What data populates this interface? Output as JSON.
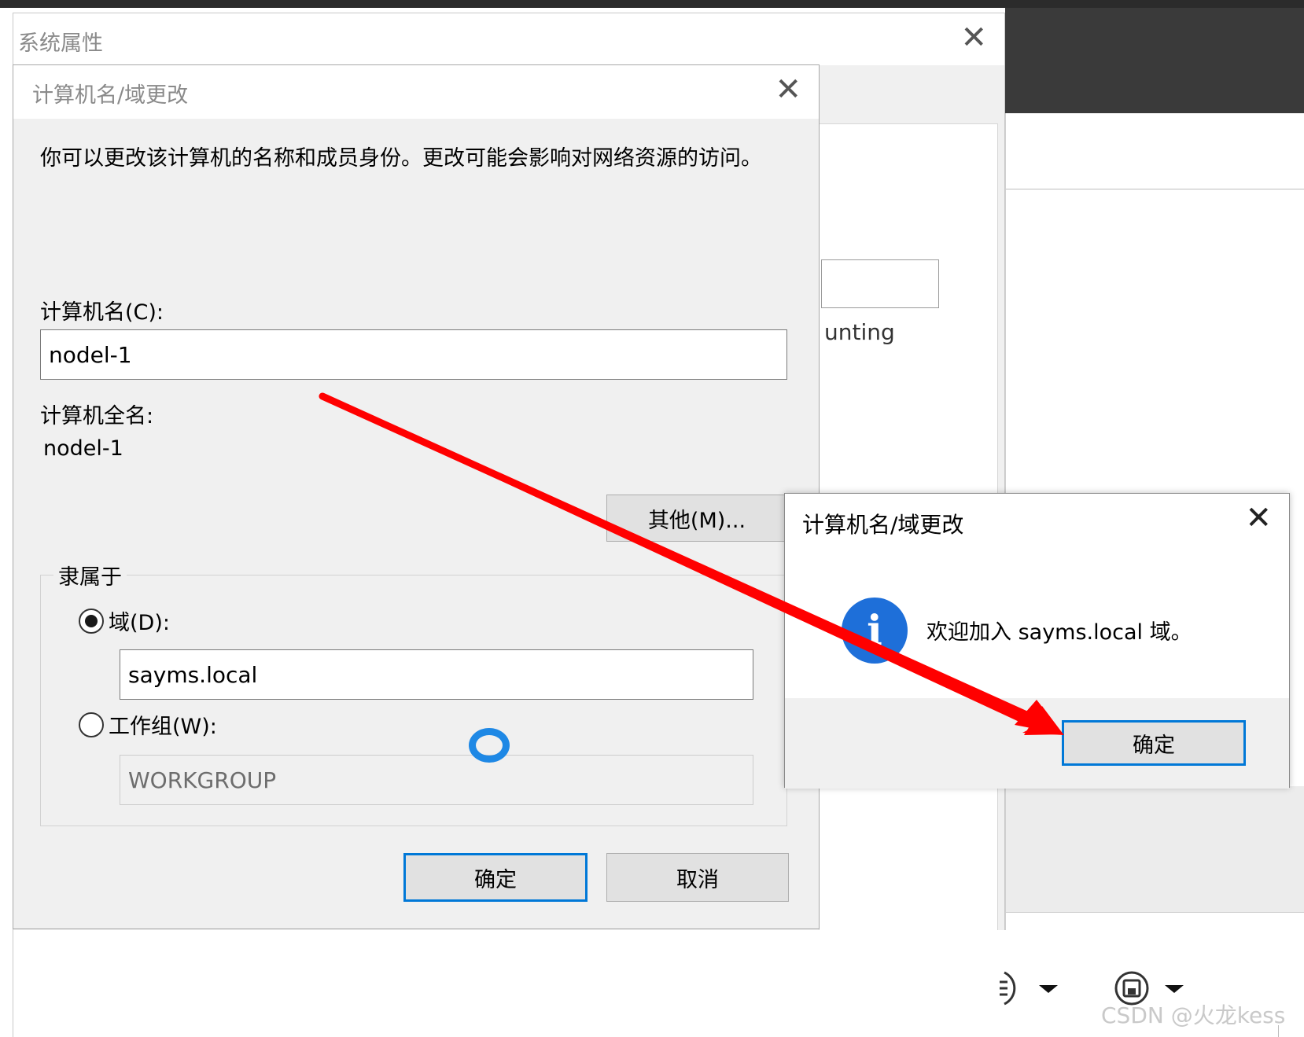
{
  "system_properties": {
    "title": "系统属性",
    "close_glyph": "✕",
    "partial_text": "unting"
  },
  "main_dialog": {
    "title": "计算机名/域更改",
    "close_glyph": "✕",
    "description": "你可以更改该计算机的名称和成员身份。更改可能会影响对网络资源的访问。",
    "computer_name_label": "计算机名(C):",
    "computer_name_value": "nodel-1",
    "full_name_label": "计算机全名:",
    "full_name_value": "nodel-1",
    "more_button": "其他(M)...",
    "member_of_legend": "隶属于",
    "domain_radio_label": "域(D):",
    "domain_value": "sayms.local",
    "domain_selected": true,
    "workgroup_radio_label": "工作组(W):",
    "workgroup_value": "WORKGROUP",
    "ok_button": "确定",
    "cancel_button": "取消"
  },
  "message_dialog": {
    "title": "计算机名/域更改",
    "close_glyph": "✕",
    "icon": "info-icon",
    "icon_glyph": "i",
    "message": "欢迎加入 sayms.local 域。",
    "ok_button": "确定"
  },
  "colors": {
    "accent": "#0078d7",
    "arrow": "#ff0000",
    "info_icon": "#1e6fd9"
  },
  "watermark": "CSDN @火龙kess"
}
